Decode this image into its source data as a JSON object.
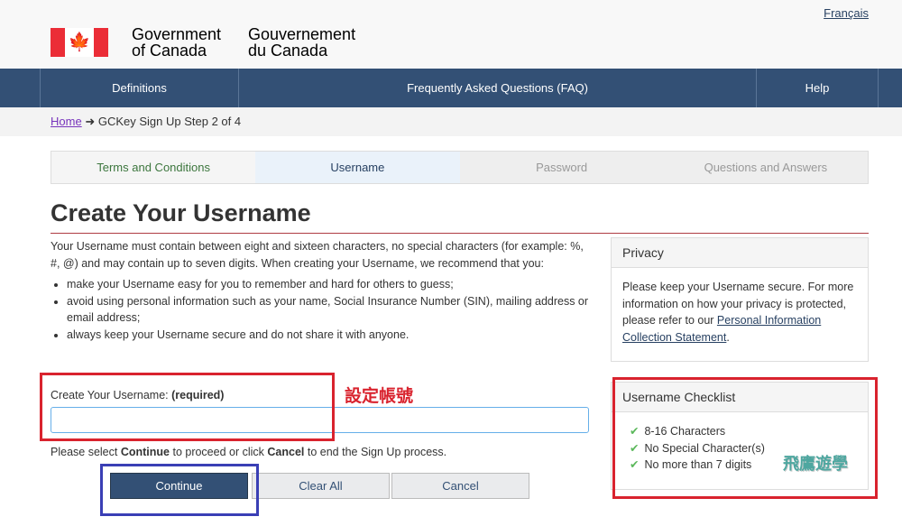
{
  "header": {
    "language_link": "Français",
    "gov_en_1": "Government",
    "gov_en_2": "of Canada",
    "gov_fr_1": "Gouvernement",
    "gov_fr_2": "du Canada"
  },
  "nav": [
    "Definitions",
    "Frequently Asked Questions (FAQ)",
    "Help"
  ],
  "breadcrumb": {
    "home": "Home",
    "arrow": "➜",
    "current": "GCKey Sign Up Step 2 of 4"
  },
  "steps": [
    "Terms and Conditions",
    "Username",
    "Password",
    "Questions and Answers"
  ],
  "title": "Create Your Username",
  "intro": "Your Username must contain between eight and sixteen characters, no special characters (for example: %, #, @) and may contain up to seven digits. When creating your Username, we recommend that you:",
  "bullets": [
    "make your Username easy for you to remember and hard for others to guess;",
    "avoid using personal information such as your name, Social Insurance Number (SIN), mailing address or email address;",
    "always keep your Username secure and do not share it with anyone."
  ],
  "privacy": {
    "heading": "Privacy",
    "text": "Please keep your Username secure. For more information on how your privacy is protected, please refer to our ",
    "link": "Personal Information Collection Statement",
    "end": "."
  },
  "checklist": {
    "heading": "Username Checklist",
    "items": [
      "8-16 Characters",
      "No Special Character(s)",
      "No more than 7 digits"
    ]
  },
  "form": {
    "label": "Create Your Username: ",
    "required": "(required)",
    "value": ""
  },
  "note": {
    "a": "Please select ",
    "b": "Continue",
    "c": " to proceed or click ",
    "d": "Cancel",
    "e": " to end the Sign Up process."
  },
  "buttons": {
    "continue": "Continue",
    "clear": "Clear All",
    "cancel": "Cancel"
  },
  "annotation": "設定帳號",
  "watermark": "飛鷹遊學"
}
